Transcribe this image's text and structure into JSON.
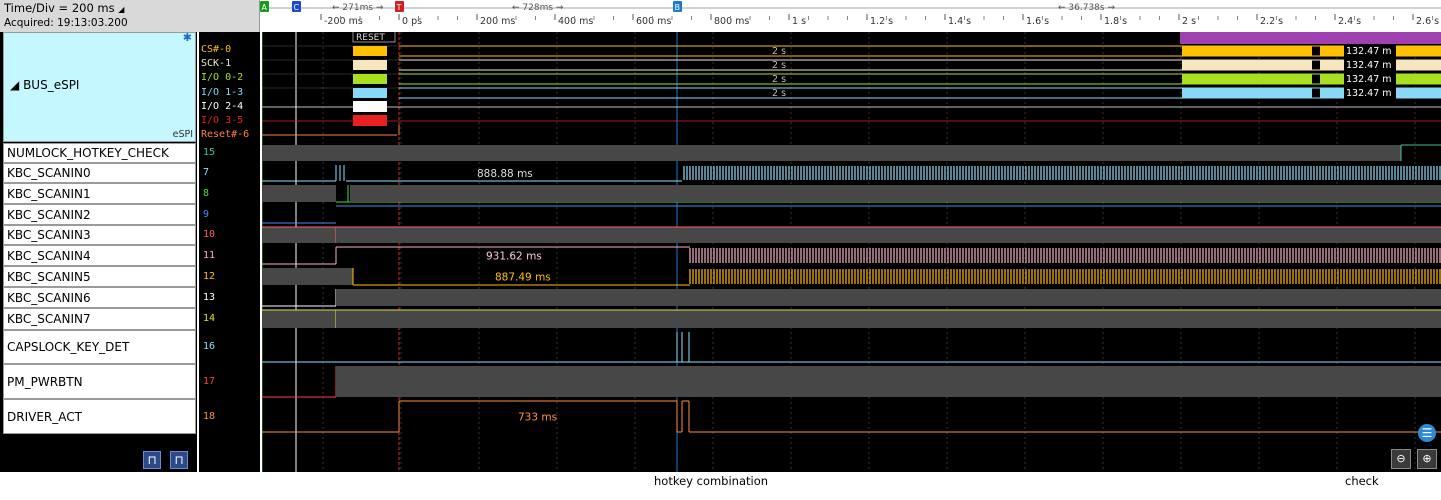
{
  "header": {
    "time_div": "Time/Div = 200 ms",
    "acquired": "Acquired: 19:13:03.200"
  },
  "ruler": {
    "ticks": [
      "-200 ms",
      "0 ps",
      "200 ms",
      "400 ms",
      "600 ms",
      "800 ms",
      "1 s",
      "1.2 s",
      "1.4 s",
      "1.6 s",
      "1.8 s",
      "2 s",
      "2.2 s",
      "2.4 s",
      "2.6 s"
    ],
    "cursor_labels": [
      "A",
      "C",
      "T",
      "B"
    ],
    "deltas": [
      "271ms",
      "728ms",
      "36.738s"
    ]
  },
  "bus": {
    "name": "BUS_eSPI",
    "tag": "eSPI",
    "lines": [
      "CS#-0",
      "SCK-1",
      "I/O 0-2",
      "I/O 1-3",
      "I/O 2-4",
      "I/O 3-5",
      "Reset#-6"
    ],
    "line_colors": [
      "#ffc000",
      "#f5e6c0",
      "#a8e020",
      "#88d8f8",
      "#ffffff",
      "#e82020",
      "#ff8040"
    ],
    "reset_label": "RESET",
    "period_labels": [
      "2 s",
      "2 s",
      "2 s",
      "2 s"
    ],
    "measure_labels": [
      "132.47 m",
      "132.47 m",
      "132.47 m",
      "132.47 m"
    ]
  },
  "signals": [
    {
      "name": "NUMLOCK_HOTKEY_CHECK",
      "channel": "15",
      "color": "#40c0a0"
    },
    {
      "name": "KBC_SCANIN0",
      "channel": "7",
      "color": "#8ee0ff"
    },
    {
      "name": "KBC_SCANIN1",
      "channel": "8",
      "color": "#40e040"
    },
    {
      "name": "KBC_SCANIN2",
      "channel": "9",
      "color": "#4090ff"
    },
    {
      "name": "KBC_SCANIN3",
      "channel": "10",
      "color": "#ff6060"
    },
    {
      "name": "KBC_SCANIN4",
      "channel": "11",
      "color": "#ffb0c8"
    },
    {
      "name": "KBC_SCANIN5",
      "channel": "12",
      "color": "#ffc000"
    },
    {
      "name": "KBC_SCANIN6",
      "channel": "13",
      "color": "#ffffff"
    },
    {
      "name": "KBC_SCANIN7",
      "channel": "14",
      "color": "#e0e040"
    },
    {
      "name": "CAPSLOCK_KEY_DET",
      "channel": "16",
      "color": "#8ee0ff"
    },
    {
      "name": "PM_PWRBTN",
      "channel": "17",
      "color": "#ff4040"
    },
    {
      "name": "DRIVER_ACT",
      "channel": "18",
      "color": "#ff9040"
    }
  ],
  "measurements": {
    "scanin0": "888.88 ms",
    "scanin4": "931.62 ms",
    "scanin5": "887.49 ms",
    "driver_act": "733 ms"
  },
  "captions": {
    "hotkey": "hotkey combination",
    "check": "check"
  }
}
